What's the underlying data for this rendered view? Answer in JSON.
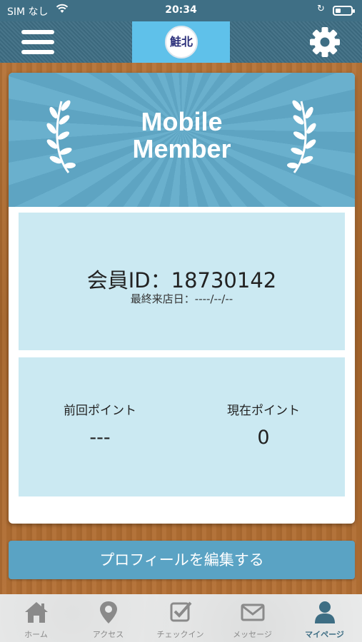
{
  "status_bar": {
    "carrier": "SIM なし",
    "time": "20:34"
  },
  "header": {
    "menu_icon": "hamburger-menu-icon",
    "logo_text": "鮭北",
    "settings_icon": "gear-icon"
  },
  "banner": {
    "title_line1": "Mobile",
    "title_line2": "Member"
  },
  "member": {
    "id_label": "会員ID：18730142",
    "last_visit_label": "最終来店日：----/--/--"
  },
  "points": {
    "previous_label": "前回ポイント",
    "previous_value": "---",
    "current_label": "現在ポイント",
    "current_value": "0"
  },
  "edit_profile_label": "プロフィールを編集する",
  "tabs": [
    {
      "label": "ホーム",
      "icon": "home-icon"
    },
    {
      "label": "アクセス",
      "icon": "map-pin-icon"
    },
    {
      "label": "チェックイン",
      "icon": "checkbox-icon"
    },
    {
      "label": "メッセージ",
      "icon": "envelope-icon"
    },
    {
      "label": "マイページ",
      "icon": "user-icon",
      "active": true
    }
  ],
  "colors": {
    "header": "#3e6e84",
    "accent": "#5aa3c4",
    "panel": "#cbe9f2",
    "logo_bg": "#5fc1ea"
  }
}
